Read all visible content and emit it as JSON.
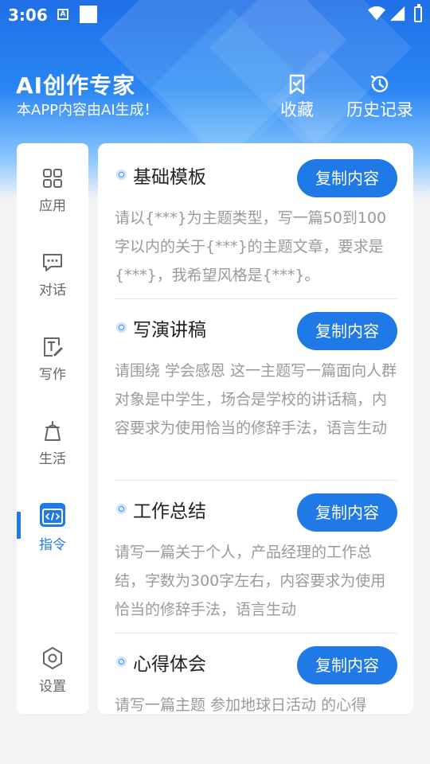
{
  "status_bar": {
    "time": "3:06",
    "notification_icon_letter": "A"
  },
  "header": {
    "title": "AI创作专家",
    "subtitle": "本APP内容由AI生成！",
    "favorites_label": "收藏",
    "history_label": "历史记录"
  },
  "sidebar": {
    "items": [
      {
        "label": "应用",
        "icon": "grid-icon"
      },
      {
        "label": "对话",
        "icon": "chat-icon"
      },
      {
        "label": "写作",
        "icon": "write-icon"
      },
      {
        "label": "生活",
        "icon": "life-icon"
      },
      {
        "label": "指令",
        "icon": "code-icon",
        "active": true
      },
      {
        "label": "设置",
        "icon": "settings-icon"
      }
    ]
  },
  "entries": [
    {
      "title": "基础模板",
      "button": "复制内容",
      "desc": "请以{***}为主题类型，写一篇50到100字以内的关于{***}的主题文章，要求是{***}，我希望风格是{***}。"
    },
    {
      "title": "写演讲稿",
      "button": "复制内容",
      "desc": "请围绕 学会感恩 这一主题写一篇面向人群对象是中学生，场合是学校的讲话稿，内容要求为使用恰当的修辞手法，语言生动"
    },
    {
      "title": "工作总结",
      "button": "复制内容",
      "desc": "请写一篇关于个人，产品经理的工作总结，字数为300字左右，内容要求为使用恰当的修辞手法，语言生动"
    },
    {
      "title": "心得体会",
      "button": "复制内容",
      "desc": "请写一篇主题 参加地球日活动 的心得"
    }
  ],
  "colors": {
    "accent": "#1f7ae8",
    "muted_text": "#9a9a9a"
  }
}
